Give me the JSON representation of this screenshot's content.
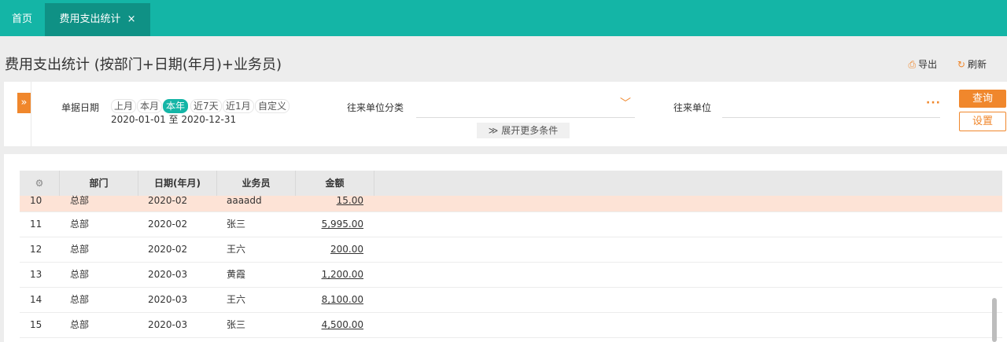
{
  "tabs": {
    "home": "首页",
    "active": "费用支出统计",
    "close": "×"
  },
  "page": {
    "title": "费用支出统计 (按部门+日期(年月)+业务员)",
    "export": "导出",
    "refresh": "刷新"
  },
  "filter": {
    "toggle_icon": "»",
    "date_label": "单据日期",
    "quick_dates": [
      "上月",
      "本月",
      "本年",
      "近7天",
      "近1月",
      "自定义"
    ],
    "selected_quick_date": "本年",
    "date_range": "2020-01-01 至 2020-12-31",
    "partner_category_label": "往来单位分类",
    "partner_label": "往来单位",
    "more_conditions": "展开更多条件",
    "query_button": "查询",
    "settings_button": "设置"
  },
  "grid": {
    "columns": [
      "部门",
      "日期(年月)",
      "业务员",
      "金额"
    ],
    "rows": [
      {
        "no": "10",
        "dept": "总部",
        "month": "2020-02",
        "staff": "aaaadd",
        "amount": "15.00",
        "selected": true
      },
      {
        "no": "11",
        "dept": "总部",
        "month": "2020-02",
        "staff": "张三",
        "amount": "5,995.00"
      },
      {
        "no": "12",
        "dept": "总部",
        "month": "2020-02",
        "staff": "王六",
        "amount": "200.00"
      },
      {
        "no": "13",
        "dept": "总部",
        "month": "2020-03",
        "staff": "黄霞",
        "amount": "1,200.00"
      },
      {
        "no": "14",
        "dept": "总部",
        "month": "2020-03",
        "staff": "王六",
        "amount": "8,100.00"
      },
      {
        "no": "15",
        "dept": "总部",
        "month": "2020-03",
        "staff": "张三",
        "amount": "4,500.00"
      }
    ]
  }
}
